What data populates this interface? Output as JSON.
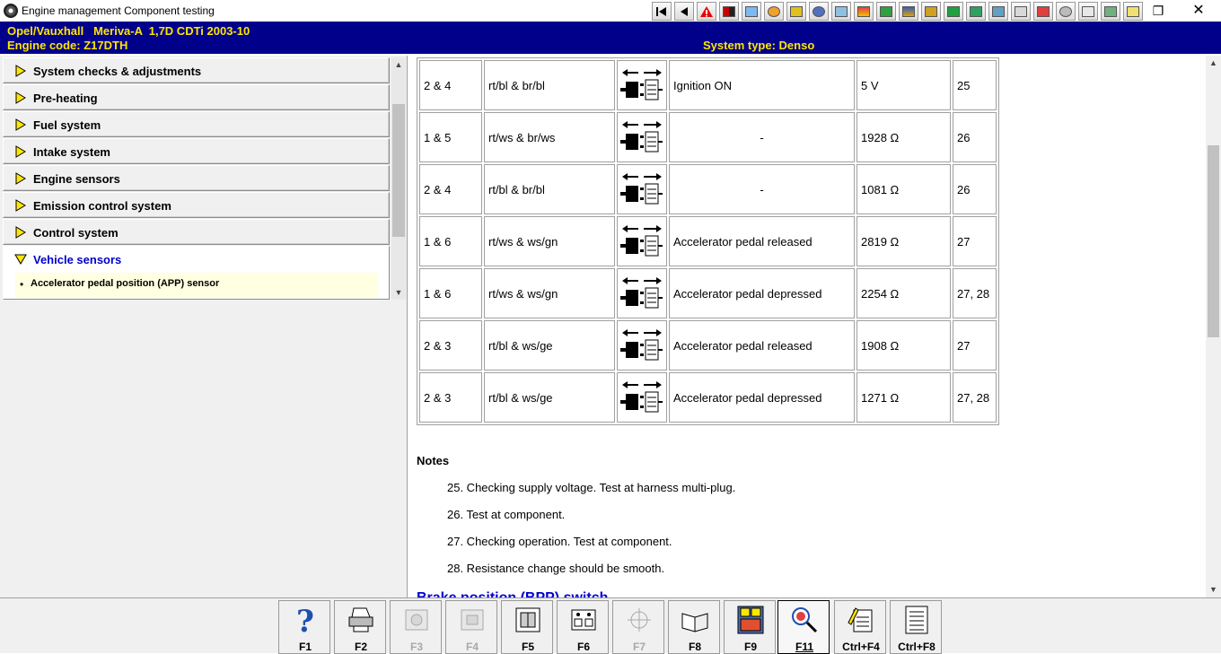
{
  "window": {
    "title": "Engine management Component testing"
  },
  "vehicle": {
    "line1": "Opel/Vauxhall   Meriva-A  1,7D CDTi 2003-10",
    "line2": "Engine code: Z17DTH",
    "system_type": "System type: Denso"
  },
  "nav": {
    "items": [
      {
        "label": "System checks & adjustments"
      },
      {
        "label": "Pre-heating"
      },
      {
        "label": "Fuel system"
      },
      {
        "label": "Intake system"
      },
      {
        "label": "Engine sensors"
      },
      {
        "label": "Emission control system"
      },
      {
        "label": "Control system"
      }
    ],
    "active": {
      "label": "Vehicle sensors",
      "sub_item": "Accelerator pedal position (APP) sensor"
    }
  },
  "table": {
    "rows": [
      {
        "pins": "2 & 4",
        "wires": "rt/bl & br/bl",
        "condition": "Ignition ON",
        "value": "5 V",
        "notes": "25"
      },
      {
        "pins": "1 & 5",
        "wires": "rt/ws & br/ws",
        "condition": "-",
        "value": "1928 Ω",
        "notes": "26"
      },
      {
        "pins": "2 & 4",
        "wires": "rt/bl & br/bl",
        "condition": "-",
        "value": "1081 Ω",
        "notes": "26"
      },
      {
        "pins": "1 & 6",
        "wires": "rt/ws & ws/gn",
        "condition": "Accelerator pedal released",
        "value": "2819 Ω",
        "notes": "27"
      },
      {
        "pins": "1 & 6",
        "wires": "rt/ws & ws/gn",
        "condition": "Accelerator pedal depressed",
        "value": "2254 Ω",
        "notes": "27, 28"
      },
      {
        "pins": "2 & 3",
        "wires": "rt/bl & ws/ge",
        "condition": "Accelerator pedal released",
        "value": "1908 Ω",
        "notes": "27"
      },
      {
        "pins": "2 & 3",
        "wires": "rt/bl & ws/ge",
        "condition": "Accelerator pedal depressed",
        "value": "1271 Ω",
        "notes": "27, 28"
      }
    ],
    "symbol_icon": "connector-plug-icon"
  },
  "notes": {
    "title": "Notes",
    "items": [
      "25. Checking supply voltage. Test at harness multi-plug.",
      "26. Test at component.",
      "27. Checking operation. Test at component.",
      "28. Resistance change should be smooth."
    ]
  },
  "next_heading": "Brake position (BPP) switch",
  "fkeys": [
    {
      "label": "F1",
      "icon": "help-icon",
      "enabled": true
    },
    {
      "label": "F2",
      "icon": "printer-icon",
      "enabled": true
    },
    {
      "label": "F3",
      "icon": "component-icon",
      "enabled": false
    },
    {
      "label": "F4",
      "icon": "component-alt-icon",
      "enabled": false
    },
    {
      "label": "F5",
      "icon": "ecu-icon",
      "enabled": true
    },
    {
      "label": "F6",
      "icon": "connector-pins-icon",
      "enabled": true
    },
    {
      "label": "F7",
      "icon": "crosshair-icon",
      "enabled": false
    },
    {
      "label": "F8",
      "icon": "book-icon",
      "enabled": true
    },
    {
      "label": "F9",
      "icon": "fuse-box-icon",
      "enabled": true
    },
    {
      "label": "F11",
      "icon": "magnifier-icon",
      "enabled": true,
      "pressed": true
    },
    {
      "label": "Ctrl+F4",
      "icon": "note-pencil-icon",
      "enabled": true
    },
    {
      "label": "Ctrl+F8",
      "icon": "list-icon",
      "enabled": true
    }
  ],
  "colors": {
    "header_bg": "#00008b",
    "header_text": "#ffe600",
    "link_blue": "#0000cc",
    "tooltip_yellow": "#ffffe1"
  }
}
